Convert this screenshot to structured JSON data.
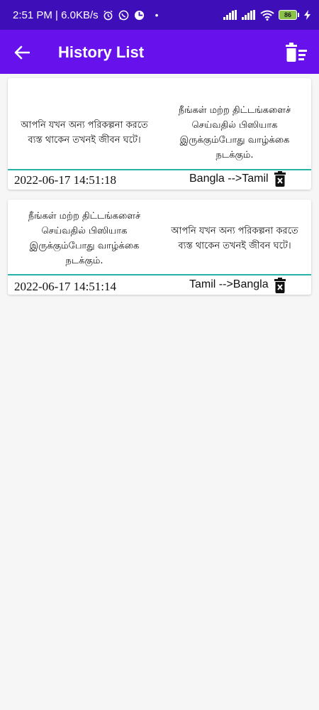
{
  "status_bar": {
    "time_speed": "2:51 PM | 6.0KB/s",
    "dot": "•",
    "battery": "86",
    "icons": [
      "alarm-icon",
      "whatsapp-icon",
      "app-icon",
      "signal-icon",
      "signal-icon",
      "wifi-icon",
      "battery-icon",
      "charging-icon"
    ]
  },
  "app_bar": {
    "title": "History List",
    "back_icon": "arrow-left-icon",
    "clear_icon": "delete-sweep-icon"
  },
  "history": [
    {
      "source_text": "আপনি যখন অন্য পরিকল্পনা করতে ব্যস্ত থাকেন তখনই জীবন ঘটে।",
      "target_text": "நீங்கள் மற்ற திட்டங்களைச் செய்வதில் பிஸியாக இருக்கும்போது வாழ்க்கை நடக்கும்.",
      "date": "2022-06-17 14:51:18",
      "lang": "Bangla -->Tamil"
    },
    {
      "source_text": "நீங்கள் மற்ற திட்டங்களைச் செய்வதில் பிஸியாக இருக்கும்போது வாழ்க்கை நடக்கும்.",
      "target_text": "আপনি যখন অন্য পরিকল্পনা করতে ব্যস্ত থাকেন তখনই জীবন ঘটে।",
      "date": "2022-06-17 14:51:14",
      "lang": "Tamil -->Bangla"
    }
  ],
  "colors": {
    "status_bar": "#3e0fb8",
    "app_bar": "#6712ec",
    "divider": "#26b5a5",
    "background": "#f6f6f7"
  }
}
